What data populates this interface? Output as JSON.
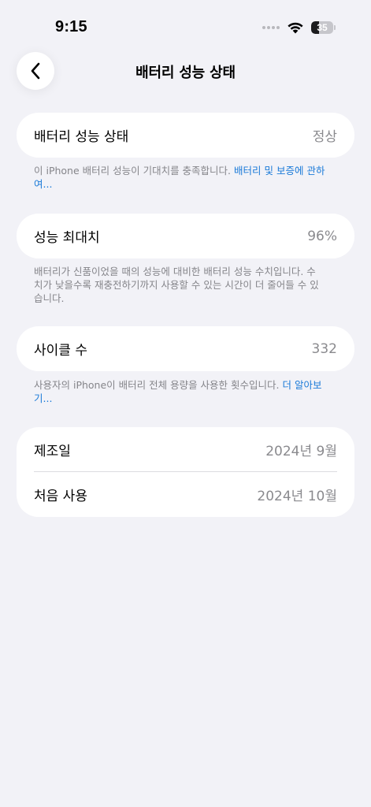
{
  "status_bar": {
    "time": "9:15",
    "battery_level": "35",
    "battery_fraction": 0.35
  },
  "nav": {
    "back_icon": "chevron-left-icon",
    "title": "배터리 성능 상태"
  },
  "sections": {
    "health": {
      "label": "배터리 성능 상태",
      "value": "정상",
      "footnote_text": "이 iPhone 배터리 성능이 기대치를 충족합니다.",
      "footnote_link": "배터리 및 보증에 관하여..."
    },
    "max_capacity": {
      "label": "성능 최대치",
      "value": "96%",
      "footnote_text": "배터리가 신품이었을 때의 성능에 대비한 배터리 성능 수치입니다. 수치가 낮을수록 재충전하기까지 사용할 수 있는 시간이 더 줄어들 수 있습니다."
    },
    "cycle_count": {
      "label": "사이클 수",
      "value": "332",
      "footnote_text": "사용자의 iPhone이 배터리 전체 용량을 사용한 횟수입니다.",
      "footnote_link": "더 알아보기..."
    },
    "dates": {
      "manufactured_label": "제조일",
      "manufactured_value": "2024년 9월",
      "first_use_label": "처음 사용",
      "first_use_value": "2024년 10월"
    }
  },
  "colors": {
    "background": "#f2f2f7",
    "card": "#ffffff",
    "secondary_text": "#8a8a8e",
    "link": "#1a7ad8"
  }
}
